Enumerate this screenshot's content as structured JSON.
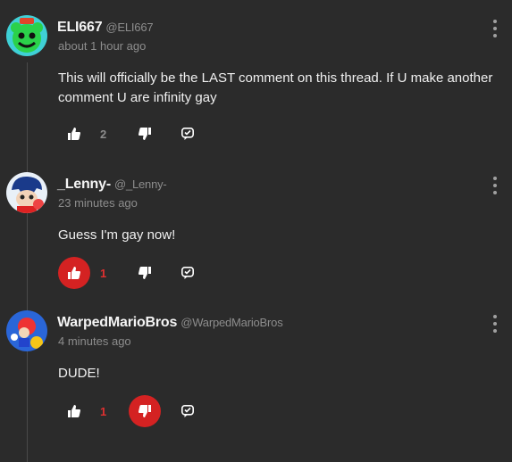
{
  "colors": {
    "background": "#2b2b2b",
    "accent": "#d42222",
    "muted": "#8d8d8d"
  },
  "comments": [
    {
      "username": "ELI667",
      "handle": "@ELI667",
      "time": "about 1 hour ago",
      "text": "This will officially be the LAST comment on this thread. If U make another comment U are infinity gay",
      "likes": "2",
      "liked": false,
      "disliked": false
    },
    {
      "username": "_Lenny-",
      "handle": "@_Lenny-",
      "time": "23 minutes ago",
      "text": "Guess I'm gay now!",
      "likes": "1",
      "liked": true,
      "disliked": false
    },
    {
      "username": "WarpedMarioBros",
      "handle": "@WarpedMarioBros",
      "time": "4 minutes ago",
      "text": "DUDE!",
      "likes": "1",
      "liked": false,
      "disliked": true
    }
  ],
  "icons": {
    "like": "thumbs-up-icon",
    "dislike": "thumbs-down-icon",
    "reply": "reply-icon",
    "menu": "more-vertical-icon"
  }
}
